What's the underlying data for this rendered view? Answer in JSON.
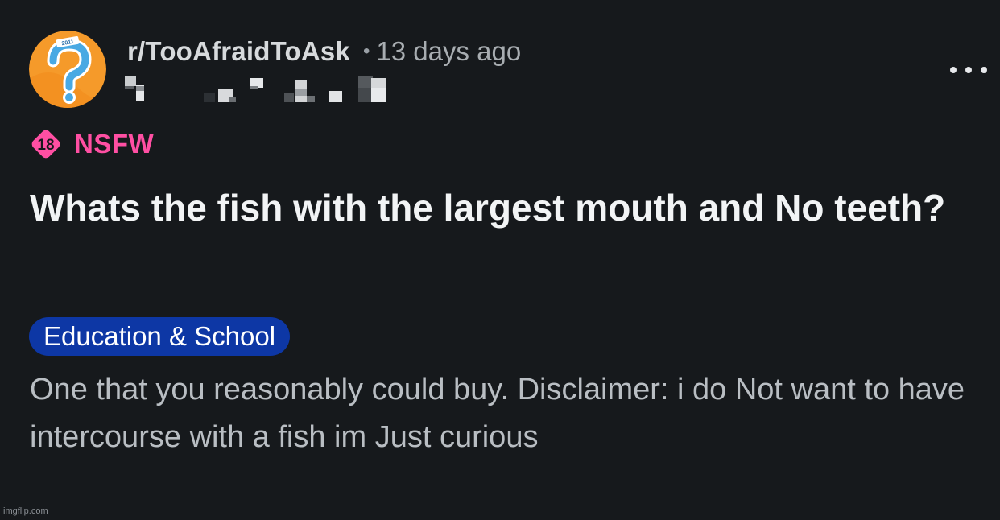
{
  "post": {
    "subreddit": "r/TooAfraidToAsk",
    "separator": "•",
    "time_ago": "13 days ago",
    "nsfw_badge": "18",
    "nsfw_label": "NSFW",
    "title": "Whats the fish with the largest mouth and No teeth?",
    "flair": "Education & School",
    "body": "One that you reasonably could buy. Disclaimer: i do Not want to have intercourse with a fish im Just curious"
  },
  "avatar": {
    "badge_text": "2011"
  },
  "watermark": "imgflip.com",
  "colors": {
    "background": "#16191c",
    "nsfw_pink": "#ff4fa3",
    "flair_blue": "#0d37a5",
    "avatar_orange": "#f59a2a"
  }
}
